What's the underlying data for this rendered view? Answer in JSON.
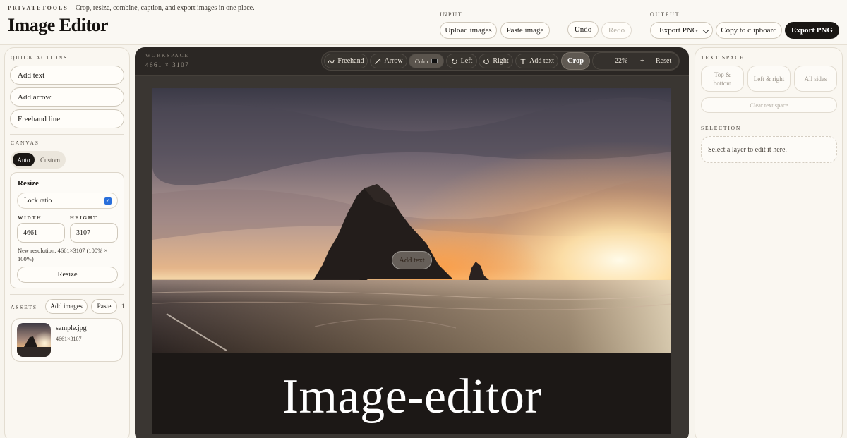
{
  "header": {
    "brand": "PRIVATETOOLS",
    "tagline": "Crop, resize, combine, caption, and export images in one place.",
    "title": "Image Editor",
    "input_label": "INPUT",
    "upload_label": "Upload images",
    "paste_label": "Paste image",
    "undo_label": "Undo",
    "redo_label": "Redo",
    "output_label": "OUTPUT",
    "export_select_value": "Export PNG",
    "copy_label": "Copy to clipboard",
    "export_button_label": "Export PNG"
  },
  "left_panel": {
    "quick_actions_label": "QUICK ACTIONS",
    "quick_actions": [
      "Add text",
      "Add arrow",
      "Freehand line"
    ],
    "canvas_label": "CANVAS",
    "canvas_modes": [
      "Auto",
      "Custom"
    ],
    "canvas_mode_selected": "Auto",
    "resize": {
      "title": "Resize",
      "lock_ratio_label": "Lock ratio",
      "lock_ratio_checked": true,
      "width_label": "WIDTH",
      "height_label": "HEIGHT",
      "width_value": "4661",
      "height_value": "3107",
      "note": "New resolution: 4661×3107 (100% × 100%)",
      "button_label": "Resize"
    },
    "assets_label": "ASSETS",
    "add_images_label": "Add images",
    "paste_label": "Paste",
    "asset_count": "1",
    "assets": [
      {
        "name": "sample.jpg",
        "dims": "4661×3107"
      }
    ]
  },
  "workspace": {
    "label": "WORKSPACE",
    "dims": "4661 × 3107",
    "toolbar": {
      "freehand": "Freehand",
      "arrow": "Arrow",
      "color": "Color",
      "color_value": "#111111",
      "left": "Left",
      "right": "Right",
      "add_text": "Add text",
      "crop": "Crop",
      "zoom_out": "-",
      "zoom": "22%",
      "zoom_in": "+",
      "reset": "Reset"
    },
    "overlay_text": "Add text",
    "caption": "Image-editor"
  },
  "right_panel": {
    "text_space_label": "TEXT SPACE",
    "text_space_options": [
      "Top & bottom",
      "Left & right",
      "All sides"
    ],
    "clear_label": "Clear text space",
    "selection_label": "SELECTION",
    "selection_placeholder": "Select a layer to edit it here."
  },
  "colors": {
    "accent_dark": "#1a1714",
    "checkbox_blue": "#2a6fdb",
    "workspace_bg": "#2b2724"
  }
}
